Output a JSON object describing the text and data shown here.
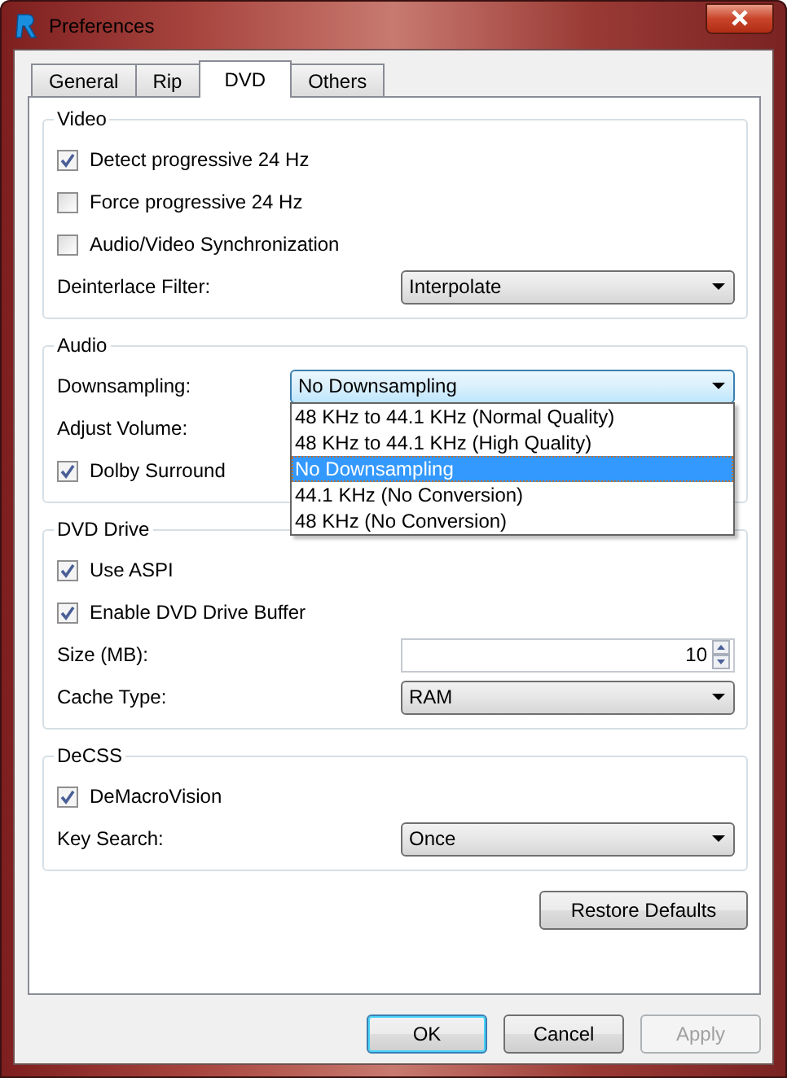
{
  "window": {
    "title": "Preferences"
  },
  "tabs": [
    {
      "label": "General",
      "selected": false
    },
    {
      "label": "Rip",
      "selected": false
    },
    {
      "label": "DVD",
      "selected": true
    },
    {
      "label": "Others",
      "selected": false
    }
  ],
  "groups": [
    {
      "title": "Video",
      "rows": [
        {
          "kind": "checkbox",
          "label": "Detect progressive 24 Hz",
          "checked": true
        },
        {
          "kind": "checkbox",
          "label": "Force progressive 24 Hz",
          "checked": false
        },
        {
          "kind": "checkbox",
          "label": "Audio/Video Synchronization",
          "checked": false
        },
        {
          "kind": "select",
          "label": "Deinterlace Filter:",
          "value": "Interpolate",
          "expanded": false
        }
      ]
    },
    {
      "title": "Audio",
      "rows": [
        {
          "kind": "select",
          "label": "Downsampling:",
          "value": "No Downsampling",
          "expanded": true,
          "options": [
            {
              "label": "48 KHz to 44.1 KHz (Normal Quality)",
              "selected": false
            },
            {
              "label": "48 KHz to 44.1 KHz (High Quality)",
              "selected": false
            },
            {
              "label": "No Downsampling",
              "selected": true
            },
            {
              "label": "44.1 KHz (No Conversion)",
              "selected": false
            },
            {
              "label": "48 KHz (No Conversion)",
              "selected": false
            }
          ]
        },
        {
          "kind": "label",
          "label": "Adjust Volume:"
        },
        {
          "kind": "checkbox",
          "label": "Dolby Surround",
          "checked": true
        }
      ]
    },
    {
      "title": "DVD Drive",
      "rows": [
        {
          "kind": "checkbox",
          "label": "Use ASPI",
          "checked": true
        },
        {
          "kind": "checkbox",
          "label": "Enable DVD Drive Buffer",
          "checked": true
        },
        {
          "kind": "spinner",
          "label": "Size (MB):",
          "value": "10"
        },
        {
          "kind": "select",
          "label": "Cache Type:",
          "value": "RAM",
          "expanded": false
        }
      ]
    },
    {
      "title": "DeCSS",
      "rows": [
        {
          "kind": "checkbox",
          "label": "DeMacroVision",
          "checked": true
        },
        {
          "kind": "select",
          "label": "Key Search:",
          "value": "Once",
          "expanded": false
        }
      ]
    }
  ],
  "restore_button": "Restore Defaults",
  "buttons": [
    {
      "label": "OK",
      "default": true,
      "disabled": false
    },
    {
      "label": "Cancel",
      "default": false,
      "disabled": false
    },
    {
      "label": "Apply",
      "default": false,
      "disabled": true
    }
  ]
}
